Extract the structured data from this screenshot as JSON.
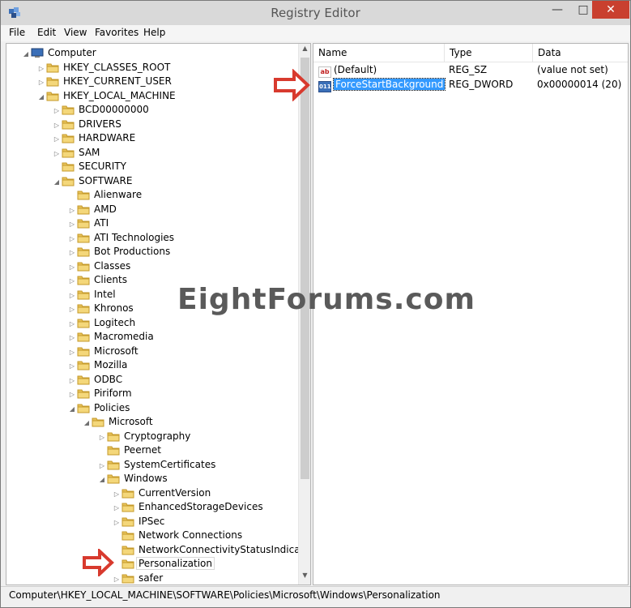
{
  "window": {
    "title": "Registry Editor"
  },
  "menu": {
    "file": "File",
    "edit": "Edit",
    "view": "View",
    "favorites": "Favorites",
    "help": "Help"
  },
  "tree": {
    "items": [
      {
        "label": "Computer",
        "expander": "◢",
        "icon": "computer-icon"
      },
      {
        "label": "HKEY_CLASSES_ROOT",
        "expander": "▷",
        "icon": "folder-icon"
      },
      {
        "label": "HKEY_CURRENT_USER",
        "expander": "▷",
        "icon": "folder-icon"
      },
      {
        "label": "HKEY_LOCAL_MACHINE",
        "expander": "◢",
        "icon": "folder-icon"
      },
      {
        "label": "BCD00000000",
        "expander": "▷",
        "icon": "folder-icon"
      },
      {
        "label": "DRIVERS",
        "expander": "▷",
        "icon": "folder-icon"
      },
      {
        "label": "HARDWARE",
        "expander": "▷",
        "icon": "folder-icon"
      },
      {
        "label": "SAM",
        "expander": "▷",
        "icon": "folder-icon"
      },
      {
        "label": "SECURITY",
        "expander": "",
        "icon": "folder-icon"
      },
      {
        "label": "SOFTWARE",
        "expander": "◢",
        "icon": "folder-icon"
      },
      {
        "label": "Alienware",
        "expander": "",
        "icon": "folder-icon"
      },
      {
        "label": "AMD",
        "expander": "▷",
        "icon": "folder-icon"
      },
      {
        "label": "ATI",
        "expander": "▷",
        "icon": "folder-icon"
      },
      {
        "label": "ATI Technologies",
        "expander": "▷",
        "icon": "folder-icon"
      },
      {
        "label": "Bot Productions",
        "expander": "▷",
        "icon": "folder-icon"
      },
      {
        "label": "Classes",
        "expander": "▷",
        "icon": "folder-icon"
      },
      {
        "label": "Clients",
        "expander": "▷",
        "icon": "folder-icon"
      },
      {
        "label": "Intel",
        "expander": "▷",
        "icon": "folder-icon"
      },
      {
        "label": "Khronos",
        "expander": "▷",
        "icon": "folder-icon"
      },
      {
        "label": "Logitech",
        "expander": "▷",
        "icon": "folder-icon"
      },
      {
        "label": "Macromedia",
        "expander": "▷",
        "icon": "folder-icon"
      },
      {
        "label": "Microsoft",
        "expander": "▷",
        "icon": "folder-icon"
      },
      {
        "label": "Mozilla",
        "expander": "▷",
        "icon": "folder-icon"
      },
      {
        "label": "ODBC",
        "expander": "▷",
        "icon": "folder-icon"
      },
      {
        "label": "Piriform",
        "expander": "▷",
        "icon": "folder-icon"
      },
      {
        "label": "Policies",
        "expander": "◢",
        "icon": "folder-icon"
      },
      {
        "label": "Microsoft",
        "expander": "◢",
        "icon": "folder-icon"
      },
      {
        "label": "Cryptography",
        "expander": "▷",
        "icon": "folder-icon"
      },
      {
        "label": "Peernet",
        "expander": "",
        "icon": "folder-icon"
      },
      {
        "label": "SystemCertificates",
        "expander": "▷",
        "icon": "folder-icon"
      },
      {
        "label": "Windows",
        "expander": "◢",
        "icon": "folder-icon"
      },
      {
        "label": "CurrentVersion",
        "expander": "▷",
        "icon": "folder-icon"
      },
      {
        "label": "EnhancedStorageDevices",
        "expander": "▷",
        "icon": "folder-icon"
      },
      {
        "label": "IPSec",
        "expander": "▷",
        "icon": "folder-icon"
      },
      {
        "label": "Network Connections",
        "expander": "",
        "icon": "folder-icon"
      },
      {
        "label": "NetworkConnectivityStatusIndicator",
        "expander": "",
        "icon": "folder-icon"
      },
      {
        "label": "Personalization",
        "expander": "",
        "icon": "folder-icon",
        "selected": true
      },
      {
        "label": "safer",
        "expander": "▷",
        "icon": "folder-icon"
      }
    ]
  },
  "list": {
    "columns": {
      "name": "Name",
      "type": "Type",
      "data": "Data"
    },
    "rows": [
      {
        "name": "(Default)",
        "type": "REG_SZ",
        "data": "(value not set)",
        "icon": "string-value-icon",
        "icon_text": "ab"
      },
      {
        "name": "ForceStartBackground",
        "type": "REG_DWORD",
        "data": "0x00000014 (20)",
        "icon": "dword-value-icon",
        "icon_text": "011"
      }
    ]
  },
  "watermark": "EightForums.com",
  "status": {
    "path": "Computer\\HKEY_LOCAL_MACHINE\\SOFTWARE\\Policies\\Microsoft\\Windows\\Personalization"
  },
  "colors": {
    "selection": "#3399ff",
    "arrow": "#d83a2e",
    "close": "#c9402f"
  }
}
